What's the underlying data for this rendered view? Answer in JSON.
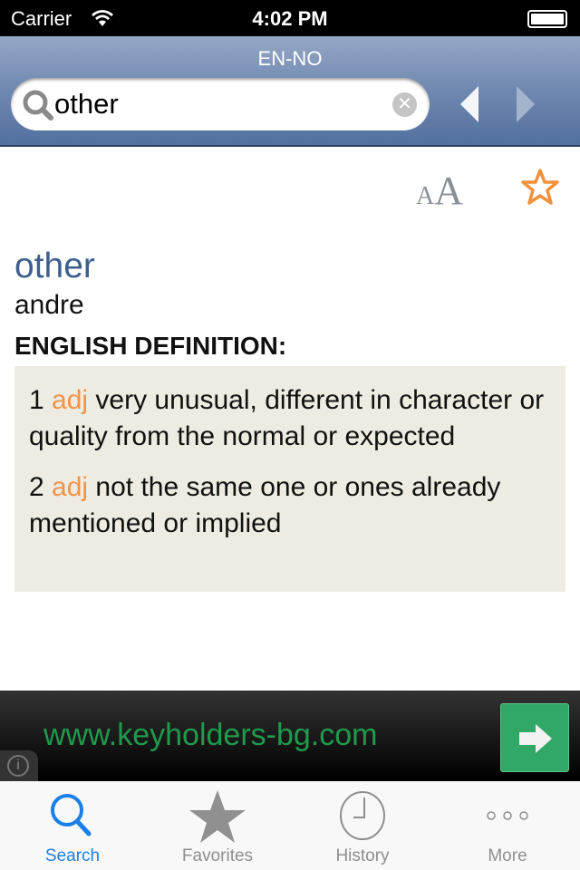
{
  "status": {
    "carrier": "Carrier",
    "time": "4:02 PM"
  },
  "nav": {
    "title": "EN-NO",
    "search_value": "other",
    "clear_icon": "clear-icon"
  },
  "toolbar": {
    "font_size_label": "A",
    "font_size_label_large": "A"
  },
  "entry": {
    "word": "other",
    "translation": "andre",
    "definition_heading": "ENGLISH DEFINITION:",
    "definitions": [
      {
        "num": "1",
        "pos": "adj",
        "text": "very unusual, different in character or quality from the normal or expected"
      },
      {
        "num": "2",
        "pos": "adj",
        "text": "not the same one or ones already mentioned or implied"
      }
    ]
  },
  "ad": {
    "url": "www.keyholders-bg.com",
    "info": "i"
  },
  "tabs": [
    {
      "label": "Search",
      "icon": "search-icon",
      "active": true
    },
    {
      "label": "Favorites",
      "icon": "star-icon"
    },
    {
      "label": "History",
      "icon": "clock-icon"
    },
    {
      "label": "More",
      "icon": "more-icon"
    }
  ],
  "colors": {
    "accent": "#1a7fe8",
    "word": "#3c5f8f",
    "pos": "#f0944a",
    "favorite": "#f0913b",
    "ad_text": "#1f9a4b"
  }
}
